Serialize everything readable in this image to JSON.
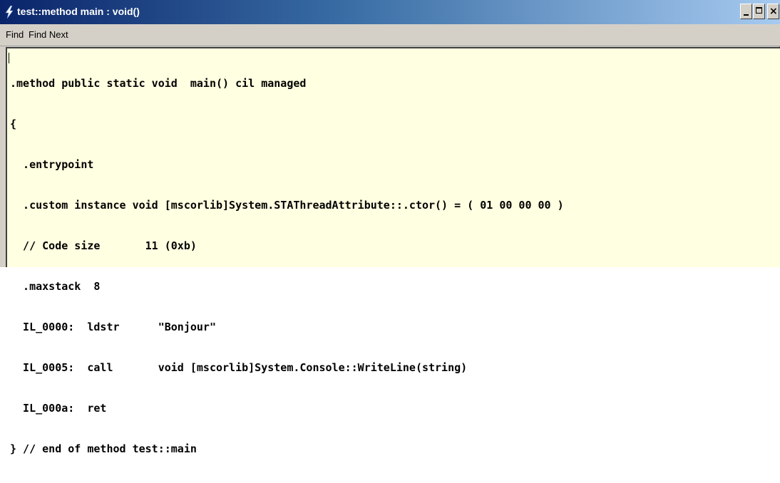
{
  "window": {
    "title": "test::method main : void()",
    "controls": {
      "minimize": "_",
      "maximize": "□",
      "close": "×"
    }
  },
  "menu": {
    "items": [
      {
        "label": "Find"
      },
      {
        "label": "Find Next"
      }
    ]
  },
  "editor": {
    "lines": [
      ".method public static void  main() cil managed",
      "{",
      "  .entrypoint",
      "  .custom instance void [mscorlib]System.STAThreadAttribute::.ctor() = ( 01 00 00 00 )",
      "  // Code size       11 (0xb)",
      "  .maxstack  8",
      "  IL_0000:  ldstr      \"Bonjour\"",
      "  IL_0005:  call       void [mscorlib]System.Console::WriteLine(string)",
      "  IL_000a:  ret",
      "} // end of method test::main"
    ],
    "background_color": "#ffffe1"
  },
  "colors": {
    "titlebar_start": "#0a246a",
    "titlebar_end": "#a6caf0",
    "chrome": "#d4d0c8"
  }
}
